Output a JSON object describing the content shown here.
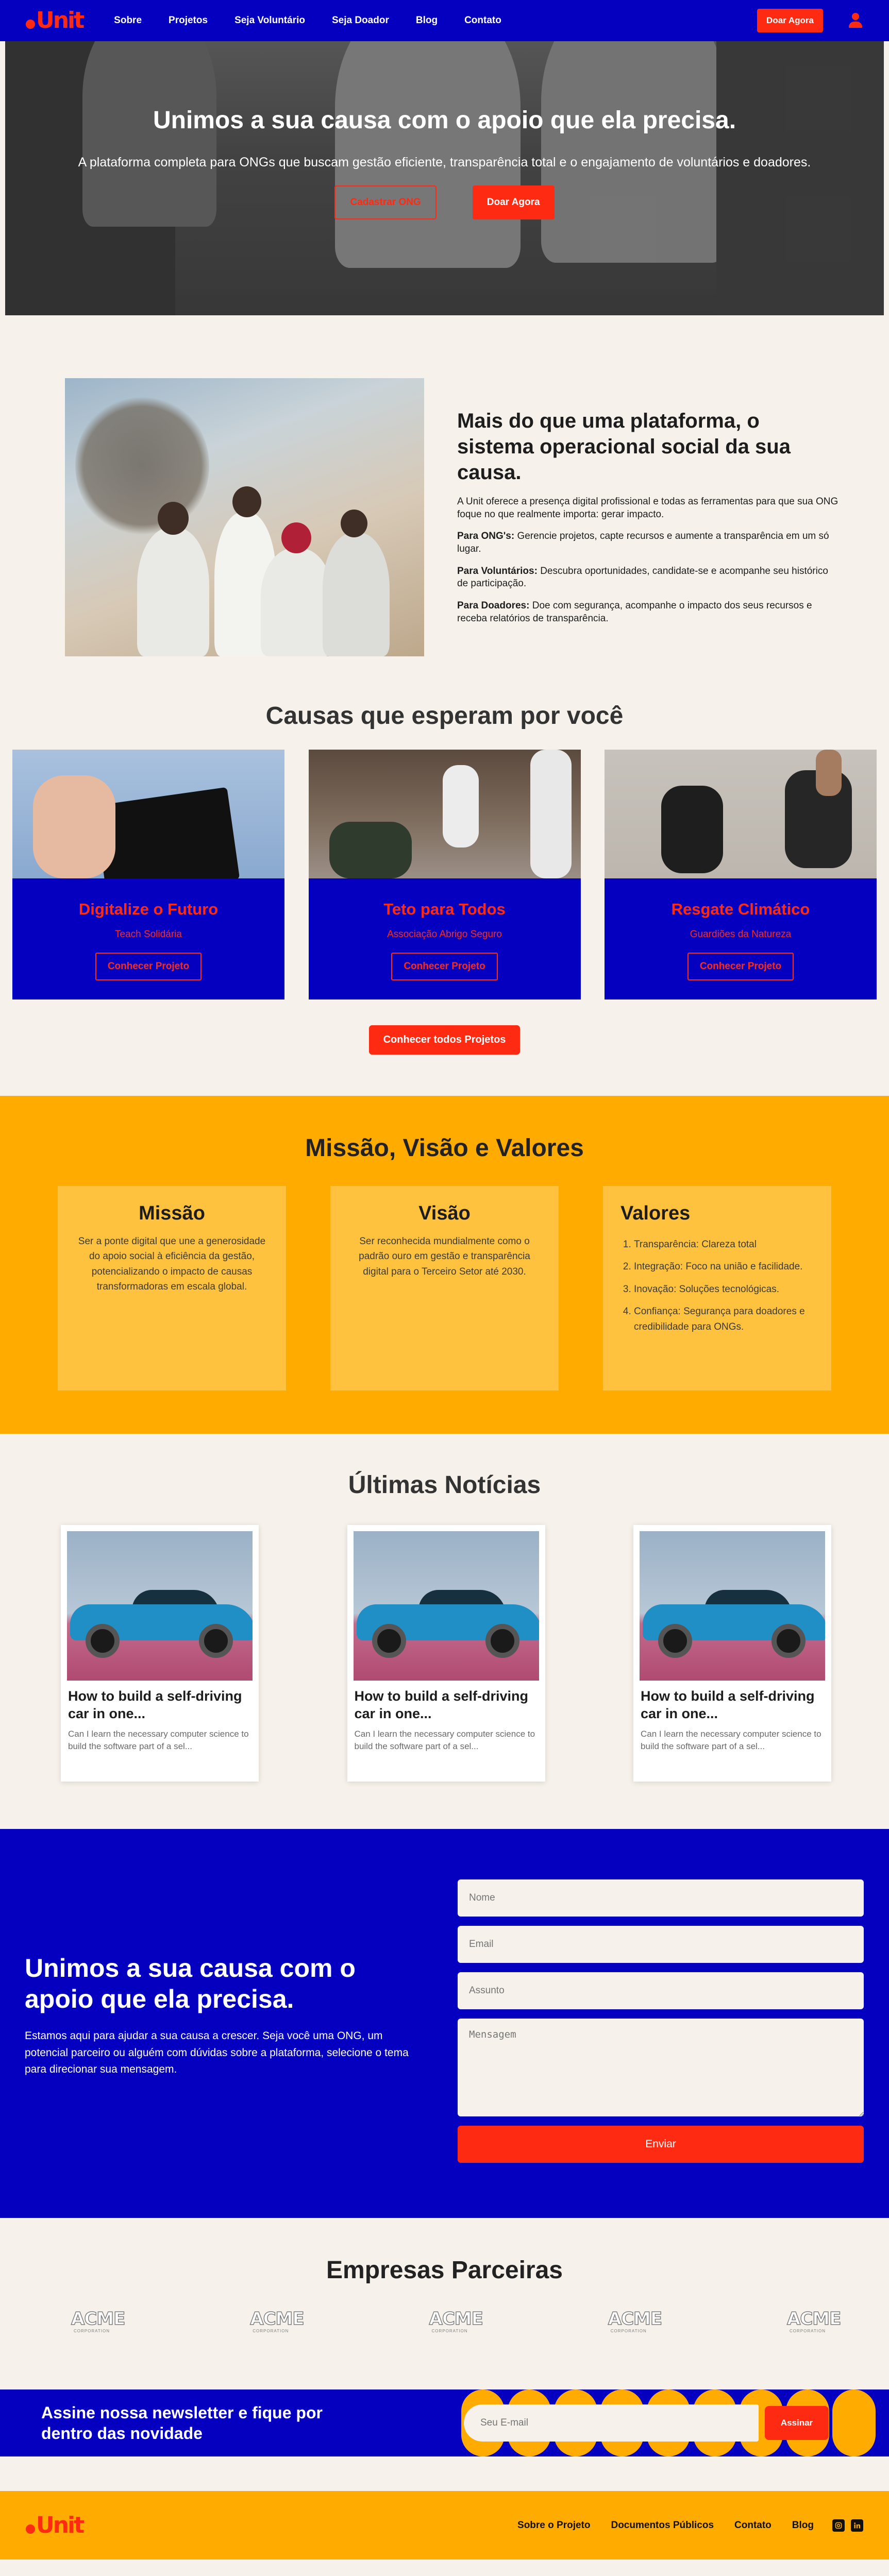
{
  "colors": {
    "primary_blue": "#0500c0",
    "accent_red": "#ff2a12",
    "accent_orange": "#ffab00",
    "cream": "#f6f1ea"
  },
  "brand": {
    "logo_text": "Unit"
  },
  "nav": {
    "links": [
      "Sobre",
      "Projetos",
      "Seja Voluntário",
      "Seja Doador",
      "Blog",
      "Contato"
    ],
    "cta": "Doar Agora",
    "user_icon": "user-icon"
  },
  "hero": {
    "title": "Unimos a sua causa com o apoio que ela precisa.",
    "subtitle": "A plataforma completa para ONGs que buscam gestão eficiente, transparência total e o engajamento de voluntários e doadores.",
    "btn_secondary": "Cadastrar ONG",
    "btn_primary": "Doar Agora"
  },
  "about": {
    "title": "Mais do que uma plataforma, o sistema operacional social da sua causa.",
    "intro": "A Unit oferece a presença digital profissional e todas as ferramentas para que sua ONG foque no que realmente importa: gerar impacto.",
    "items": [
      {
        "label": "Para ONG's:",
        "text": "Gerencie projetos, capte recursos e aumente a transparência em um só lugar."
      },
      {
        "label": "Para Voluntários:",
        "text": "Descubra oportunidades, candidate-se e acompanhe seu histórico de participação."
      },
      {
        "label": "Para Doadores:",
        "text": "Doe com segurança, acompanhe o impacto dos seus recursos e receba relatórios de transparência."
      }
    ]
  },
  "causes": {
    "title": "Causas que esperam por você",
    "cards": [
      {
        "title": "Digitalize o Futuro",
        "org": "Teach Solidária",
        "button": "Conhecer Projeto"
      },
      {
        "title": "Teto para Todos",
        "org": "Associação Abrigo Seguro",
        "button": "Conhecer Projeto"
      },
      {
        "title": "Resgate Climático",
        "org": "Guardiões da Natureza",
        "button": "Conhecer Projeto"
      }
    ],
    "all_button": "Conhecer todos Projetos"
  },
  "mvv": {
    "title": "Missão, Visão e Valores",
    "mission": {
      "title": "Missão",
      "text": "Ser a ponte digital que une a generosidade do apoio social à eficiência da gestão, potencializando o impacto de causas transformadoras em escala global."
    },
    "vision": {
      "title": "Visão",
      "text": "Ser reconhecida mundialmente como o padrão ouro em gestão e transparência digital para o Terceiro Setor até 2030."
    },
    "values": {
      "title": "Valores",
      "items": [
        "Transparência: Clareza total",
        "Integração: Foco na união e facilidade.",
        "Inovação: Soluções tecnológicas.",
        "Confiança: Segurança para doadores e credibilidade para ONGs."
      ]
    }
  },
  "news": {
    "title": "Últimas Notícias",
    "cards": [
      {
        "title": "How to build a self-driving car in one...",
        "excerpt": "Can I learn the necessary computer science to build the software part of a sel..."
      },
      {
        "title": "How to build a self-driving car in one...",
        "excerpt": "Can I learn the necessary computer science to build the software part of a sel..."
      },
      {
        "title": "How to build a self-driving car in one...",
        "excerpt": "Can I learn the necessary computer science to build the software part of a sel..."
      }
    ]
  },
  "contact": {
    "title": "Unimos a sua causa com o apoio que ela precisa.",
    "text": "Estamos aqui para ajudar a sua causa a crescer. Seja você uma ONG, um potencial parceiro ou alguém com dúvidas sobre a plataforma, selecione o tema para direcionar sua mensagem.",
    "placeholders": {
      "name": "Nome",
      "email": "Email",
      "subject": "Assunto",
      "message": "Mensagem"
    },
    "submit": "Enviar"
  },
  "partners": {
    "title": "Empresas Parceiras",
    "logos": [
      {
        "mark": "ACME",
        "sub": "CORPORATION"
      },
      {
        "mark": "ACME",
        "sub": "CORPORATION"
      },
      {
        "mark": "ACME",
        "sub": "CORPORATION"
      },
      {
        "mark": "ACME",
        "sub": "CORPORATION"
      },
      {
        "mark": "ACME",
        "sub": "CORPORATION"
      }
    ]
  },
  "newsletter": {
    "title": "Assine nossa newsletter e fique por dentro das novidade",
    "placeholder": "Seu E-mail",
    "button": "Assinar"
  },
  "footer": {
    "links": [
      "Sobre o Projeto",
      "Documentos Públicos",
      "Contato",
      "Blog"
    ],
    "socials": [
      "instagram-icon",
      "linkedin-icon"
    ]
  }
}
